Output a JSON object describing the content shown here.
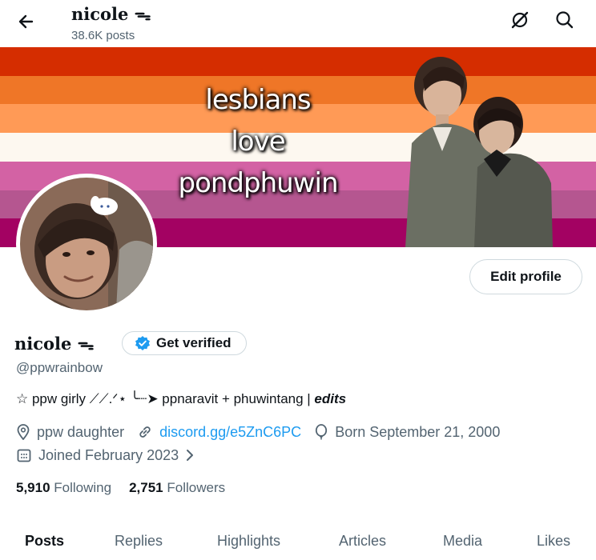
{
  "header": {
    "name": "nicole ᯓ",
    "posts_count": "38.6K posts",
    "back_icon": "arrow-left-icon",
    "icons": [
      "grok-icon",
      "search-icon"
    ]
  },
  "banner": {
    "text_lines": [
      "lesbians",
      "love",
      "pondphuwin"
    ],
    "stripe_colors": [
      "#d52d00",
      "#ef7627",
      "#ff9a56",
      "#fdf8f0",
      "#d362a4",
      "#b55690",
      "#a30262"
    ]
  },
  "profile": {
    "edit_label": "Edit profile",
    "display_name": "nicole ᯓ",
    "verify_label": "Get verified",
    "handle": "@ppwrainbow",
    "bio_text": "☆ ppw girly ⟋⟋.ᐟ⋆ ╰┈➤ ppnaravit + phuwintang | ",
    "bio_bold": "edits",
    "location": "ppw daughter",
    "link": "discord.gg/e5ZnC6PC",
    "birthday": "Born September 21, 2000",
    "joined": "Joined February 2023",
    "following_count": "5,910",
    "following_label": "Following",
    "followers_count": "2,751",
    "followers_label": "Followers"
  },
  "tabs": [
    "Posts",
    "Replies",
    "Highlights",
    "Articles",
    "Media",
    "Likes"
  ],
  "colors": {
    "text": "#0f1419",
    "secondary": "#536471",
    "link": "#1d9bf0",
    "border": "#cfd9de"
  }
}
